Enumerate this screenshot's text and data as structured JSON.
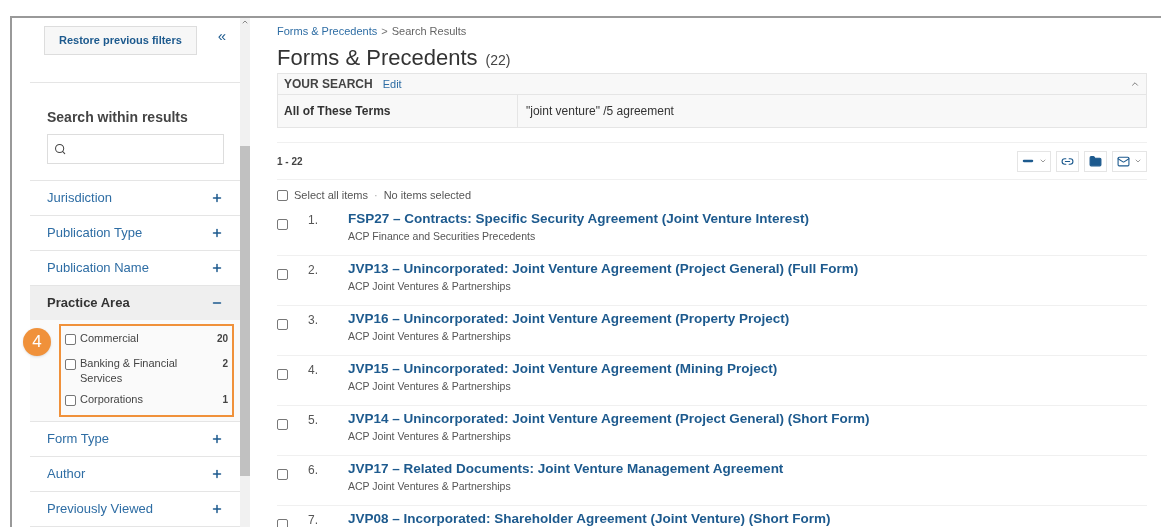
{
  "sidebar": {
    "restore_button": "Restore previous filters",
    "collapse_icon": "«",
    "search": {
      "heading": "Search within results"
    },
    "facets": [
      {
        "label": "Jurisdiction",
        "expanded": false
      },
      {
        "label": "Publication Type",
        "expanded": false
      },
      {
        "label": "Publication Name",
        "expanded": false
      },
      {
        "label": "Practice Area",
        "expanded": true,
        "callout": "4",
        "options": [
          {
            "label": "Commercial",
            "count": "20",
            "checked": false
          },
          {
            "label": "Banking & Financial Services",
            "count": "2",
            "checked": false
          },
          {
            "label": "Corporations",
            "count": "1",
            "checked": false
          }
        ]
      },
      {
        "label": "Form Type",
        "expanded": false
      },
      {
        "label": "Author",
        "expanded": false
      },
      {
        "label": "Previously Viewed",
        "expanded": false
      }
    ]
  },
  "breadcrumb": {
    "link": "Forms & Precedents",
    "separator": ">",
    "current": "Search Results"
  },
  "title": "Forms & Precedents",
  "count": "(22)",
  "your_search": {
    "label": "YOUR SEARCH",
    "edit": "Edit",
    "expanded": true,
    "term_label": "All of These Terms",
    "term_value": "\"joint venture\" /5 agreement"
  },
  "range": "1 - 22",
  "select_all": {
    "label": "Select all items",
    "checked": false,
    "separator": "·",
    "status": "No items selected"
  },
  "results": [
    {
      "number": "1.",
      "title": "FSP27 – Contracts: Specific Security Agreement (Joint Venture Interest)",
      "source": "ACP Finance and Securities Precedents",
      "checked": false
    },
    {
      "number": "2.",
      "title": "JVP13 – Unincorporated: Joint Venture Agreement (Project General) (Full Form)",
      "source": "ACP Joint Ventures & Partnerships",
      "checked": false
    },
    {
      "number": "3.",
      "title": "JVP16 – Unincorporated: Joint Venture Agreement (Property Project)",
      "source": "ACP Joint Ventures & Partnerships",
      "checked": false
    },
    {
      "number": "4.",
      "title": "JVP15 – Unincorporated: Joint Venture Agreement (Mining Project)",
      "source": "ACP Joint Ventures & Partnerships",
      "checked": false
    },
    {
      "number": "5.",
      "title": "JVP14 – Unincorporated: Joint Venture Agreement (Project General) (Short Form)",
      "source": "ACP Joint Ventures & Partnerships",
      "checked": false
    },
    {
      "number": "6.",
      "title": "JVP17 – Related Documents: Joint Venture Management Agreement",
      "source": "ACP Joint Ventures & Partnerships",
      "checked": false
    },
    {
      "number": "7.",
      "title": "JVP08 – Incorporated: Shareholder Agreement (Joint Venture) (Short Form)",
      "checked": false
    }
  ]
}
